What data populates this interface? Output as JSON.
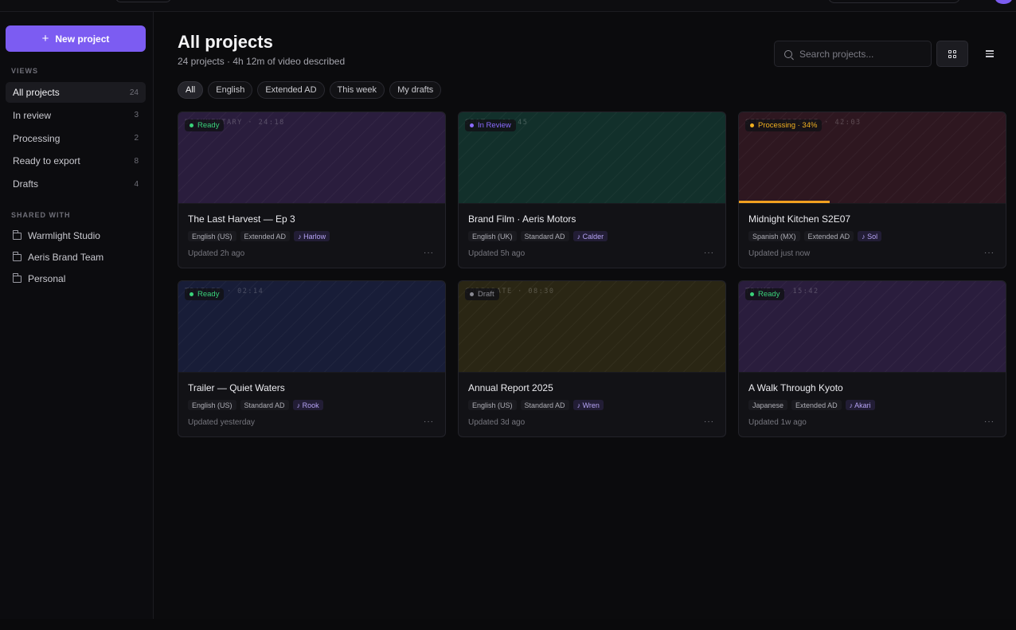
{
  "colors": {
    "accent": "#7c5cf2",
    "ready": "#3ad27a",
    "in_review": "#8b6bff",
    "processing": "#f0b020",
    "draft": "#8a8a92"
  },
  "sidebar": {
    "new_project_label": "New project",
    "views_label": "VIEWS",
    "views": [
      {
        "label": "All projects",
        "count": "24"
      },
      {
        "label": "In review",
        "count": "3"
      },
      {
        "label": "Processing",
        "count": "2"
      },
      {
        "label": "Ready to export",
        "count": "8"
      },
      {
        "label": "Drafts",
        "count": "4"
      }
    ],
    "shared_label": "SHARED WITH",
    "shared": [
      {
        "label": "Warmlight Studio",
        "icon": "folder-icon"
      },
      {
        "label": "Aeris Brand Team",
        "icon": "folder-icon"
      },
      {
        "label": "Personal",
        "icon": "folder-icon"
      }
    ]
  },
  "header": {
    "title": "All projects",
    "subtitle": "24 projects · 4h 12m of video described",
    "search_placeholder": "Search projects..."
  },
  "filters": [
    "All",
    "English",
    "Extended AD",
    "This week",
    "My drafts"
  ],
  "projects": [
    {
      "title": "The Last Harvest — Ep 3",
      "meta": "DOCUMENTARY · 24:18",
      "status": "Ready",
      "status_color": "#3ad27a",
      "thumb_color": "#2a1d3d",
      "tags": [
        "English (US)",
        "Extended AD"
      ],
      "voice": "♪ Harlow",
      "updated": "Updated 2h ago"
    },
    {
      "title": "Brand Film · Aeris Motors",
      "meta": "SPOT · 01:45",
      "status": "In Review",
      "status_color": "#8b6bff",
      "thumb_color": "#12302b",
      "tags": [
        "English (UK)",
        "Standard AD"
      ],
      "voice": "♪ Calder",
      "updated": "Updated 5h ago"
    },
    {
      "title": "Midnight Kitchen S2E07",
      "meta": "SERIES EPISODE · 42:03",
      "status": "Processing · 34%",
      "status_color": "#f0b020",
      "thumb_color": "#2e1720",
      "progress": 0.34,
      "tags": [
        "Spanish (MX)",
        "Extended AD"
      ],
      "voice": "♪ Sol",
      "updated": "Updated just now"
    },
    {
      "title": "Trailer — Quiet Waters",
      "meta": "TRAILER · 02:14",
      "status": "Ready",
      "status_color": "#3ad27a",
      "thumb_color": "#181d38",
      "tags": [
        "English (US)",
        "Standard AD"
      ],
      "voice": "♪ Rook",
      "updated": "Updated yesterday"
    },
    {
      "title": "Annual Report 2025",
      "meta": "CORPORATE · 08:30",
      "status": "Draft",
      "status_color": "#8a8a92",
      "thumb_color": "#2a2614",
      "tags": [
        "English (US)",
        "Standard AD"
      ],
      "voice": "♪ Wren",
      "updated": "Updated 3d ago"
    },
    {
      "title": "A Walk Through Kyoto",
      "meta": "TRAVEL · 15:42",
      "status": "Ready",
      "status_color": "#3ad27a",
      "thumb_color": "#2a1d3d",
      "tags": [
        "Japanese",
        "Extended AD"
      ],
      "voice": "♪ Akari",
      "updated": "Updated 1w ago"
    }
  ]
}
